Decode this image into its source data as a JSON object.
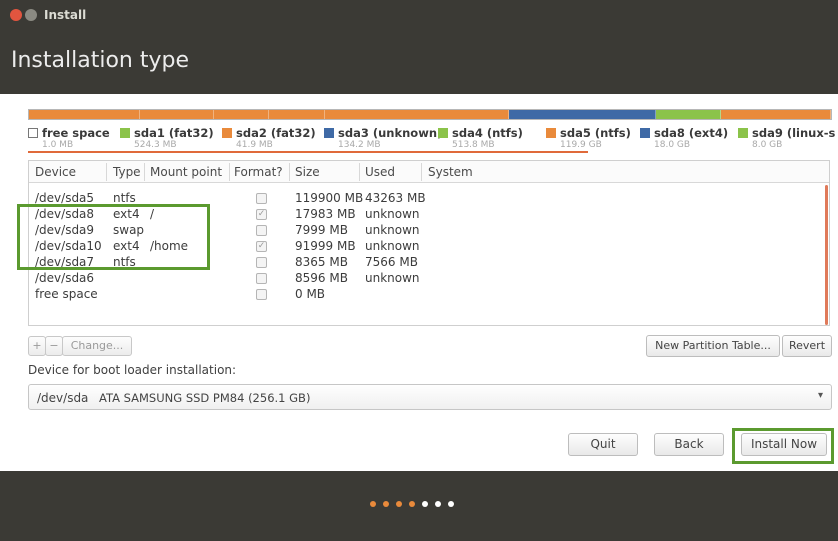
{
  "window": {
    "title": "Install"
  },
  "page": {
    "title": "Installation type"
  },
  "partition_bar": {
    "segments": [
      {
        "name": "sda1",
        "color": "#e98a3b"
      },
      {
        "name": "sda2",
        "color": "#e98a3b"
      },
      {
        "name": "sda3",
        "color": "#e98a3b"
      },
      {
        "name": "sda4",
        "color": "#e98a3b"
      },
      {
        "name": "sda5",
        "color": "#e98a3b"
      },
      {
        "name": "sda8",
        "color": "#3f6aa6"
      },
      {
        "name": "sda9",
        "color": "#8bc34a"
      },
      {
        "name": "other",
        "color": "#e98a3b"
      }
    ]
  },
  "legend": [
    {
      "name": "free space",
      "size": "1.0 MB",
      "color": "#ffffff"
    },
    {
      "name": "sda1 (fat32)",
      "size": "524.3 MB",
      "color": "#8bc34a"
    },
    {
      "name": "sda2 (fat32)",
      "size": "41.9 MB",
      "color": "#e98a3b"
    },
    {
      "name": "sda3 (unknown)",
      "size": "134.2 MB",
      "color": "#3f6aa6"
    },
    {
      "name": "sda4 (ntfs)",
      "size": "513.8 MB",
      "color": "#8bc34a"
    },
    {
      "name": "sda5 (ntfs)",
      "size": "119.9 GB",
      "color": "#e98a3b"
    },
    {
      "name": "sda8 (ext4)",
      "size": "18.0 GB",
      "color": "#3f6aa6"
    },
    {
      "name": "sda9 (linux-s",
      "size": "8.0 GB",
      "color": "#8bc34a"
    }
  ],
  "table": {
    "columns": [
      "Device",
      "Type",
      "Mount point",
      "Format?",
      "Size",
      "Used",
      "System"
    ],
    "rows": [
      {
        "device": "/dev/sda5",
        "type": "ntfs",
        "mount": "",
        "format": false,
        "size": "119900 MB",
        "used": "43263 MB"
      },
      {
        "device": "/dev/sda8",
        "type": "ext4",
        "mount": "/",
        "format": true,
        "size": "17983 MB",
        "used": "unknown"
      },
      {
        "device": "/dev/sda9",
        "type": "swap",
        "mount": "",
        "format": false,
        "size": "7999 MB",
        "used": "unknown"
      },
      {
        "device": "/dev/sda10",
        "type": "ext4",
        "mount": "/home",
        "format": true,
        "size": "91999 MB",
        "used": "unknown"
      },
      {
        "device": "/dev/sda7",
        "type": "ntfs",
        "mount": "",
        "format": false,
        "size": "8365 MB",
        "used": "7566 MB"
      },
      {
        "device": "/dev/sda6",
        "type": "",
        "mount": "",
        "format": false,
        "size": "8596 MB",
        "used": "unknown"
      },
      {
        "device": "free space",
        "type": "",
        "mount": "",
        "format": false,
        "size": "0 MB",
        "used": ""
      }
    ]
  },
  "partition_buttons": {
    "add": "+",
    "remove": "−",
    "change": "Change...",
    "new_table": "New Partition Table...",
    "revert": "Revert"
  },
  "bootloader": {
    "label": "Device for boot loader installation:",
    "device": "/dev/sda",
    "description": "ATA SAMSUNG SSD PM84 (256.1 GB)"
  },
  "actions": {
    "quit": "Quit",
    "back": "Back",
    "install": "Install Now"
  },
  "progress": {
    "total_steps": 7,
    "completed_steps": 4,
    "completed_color": "#e98a3b",
    "pending_color": "#ffffff"
  }
}
